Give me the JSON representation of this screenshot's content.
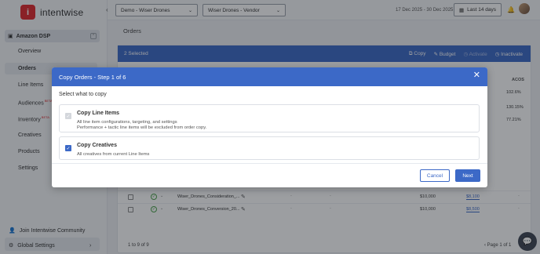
{
  "app": {
    "brand": "intentwise"
  },
  "sidebar": {
    "section": "Amazon DSP",
    "items": [
      {
        "label": "Overview"
      },
      {
        "label": "Orders"
      },
      {
        "label": "Line Items"
      },
      {
        "label": "Audiences",
        "badge": "BETA"
      },
      {
        "label": "Inventory",
        "badge": "BETA"
      },
      {
        "label": "Creatives"
      },
      {
        "label": "Products"
      },
      {
        "label": "Settings"
      }
    ],
    "community": "Join Intentwise Community",
    "global_settings": "Global Settings"
  },
  "topbar": {
    "account_select": "Demo - Wiser Drones",
    "vendor_select": "Wiser Drones - Vendor",
    "date_range": "17 Dec 2025 - 30 Dec 2025",
    "date_button": "Last 14 days"
  },
  "page": {
    "title": "Orders",
    "selection_count": "2 Selected",
    "actions": {
      "copy": "Copy",
      "budget": "Budget",
      "activate": "Activate",
      "inactivate": "Inactivate"
    },
    "acos_header": "ACOS",
    "acos_values": [
      "102.6%",
      "130.15%",
      "77.21%"
    ],
    "rows": [
      {
        "name": "Wiser_Drones_Consideration_...",
        "amount": "$10,000",
        "budget": "$8,100"
      },
      {
        "name": "Wiser_Drones_Conversion_20...",
        "amount": "$10,000",
        "budget": "$8,500"
      }
    ],
    "pager_left": "1 to 9 of 9",
    "pager_right": "Page 1 of 1"
  },
  "modal": {
    "title": "Copy Orders - Step 1 of 6",
    "subtitle": "Select what to copy",
    "options": [
      {
        "title": "Copy Line Items",
        "desc1": "All line item configurations, targeting, and settings",
        "desc2": "Performance + tactic line items will be excluded from order copy."
      },
      {
        "title": "Copy Creatives",
        "desc1": "All creatives from current Line Items"
      }
    ],
    "cancel": "Cancel",
    "next": "Next"
  },
  "colors": {
    "accent": "#3c69c7",
    "brand": "#e0282e"
  }
}
